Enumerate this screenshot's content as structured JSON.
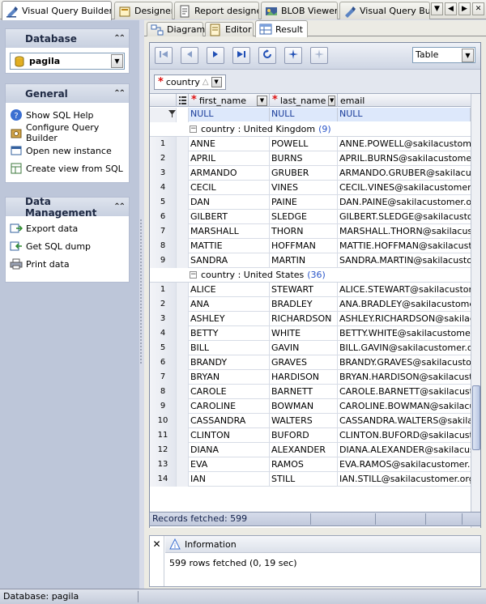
{
  "doc_tabs": [
    {
      "label": "Visual Query Builder",
      "icon": "query-builder-icon",
      "active": true
    },
    {
      "label": "Designer",
      "icon": "designer-icon",
      "active": false
    },
    {
      "label": "Report designer",
      "icon": "report-icon",
      "active": false
    },
    {
      "label": "BLOB Viewer",
      "icon": "blob-icon",
      "active": false
    },
    {
      "label": "Visual Query Builde",
      "icon": "query-builder-icon",
      "active": false
    }
  ],
  "sidebar": {
    "database_panel": {
      "title": "Database",
      "selected_db": "pagila"
    },
    "general_panel": {
      "title": "General",
      "items": [
        {
          "label": "Show SQL Help",
          "icon": "help-icon"
        },
        {
          "label": "Configure Query Builder",
          "icon": "configure-icon"
        },
        {
          "label": "Open new instance",
          "icon": "new-window-icon"
        },
        {
          "label": "Create view from SQL",
          "icon": "create-view-icon"
        }
      ]
    },
    "data_panel": {
      "title": "Data Management",
      "items": [
        {
          "label": "Export data",
          "icon": "export-icon"
        },
        {
          "label": "Get SQL dump",
          "icon": "sql-dump-icon"
        },
        {
          "label": "Print data",
          "icon": "printer-icon"
        }
      ]
    }
  },
  "sub_tabs": [
    {
      "label": "Diagram",
      "active": false
    },
    {
      "label": "Editor",
      "active": false
    },
    {
      "label": "Result",
      "active": true
    }
  ],
  "view_mode": "Table",
  "group_by": {
    "field": "country"
  },
  "columns": [
    {
      "name": "first_name",
      "required": true
    },
    {
      "name": "last_name",
      "required": true
    },
    {
      "name": "email",
      "required": false
    }
  ],
  "filter_values": [
    "NULL",
    "NULL",
    "NULL"
  ],
  "groups": [
    {
      "label": "country : United Kingdom",
      "count": "(9)",
      "rows": [
        {
          "n": "1",
          "first": "ANNE",
          "last": "POWELL",
          "email": "ANNE.POWELL@sakilacustomer.org"
        },
        {
          "n": "2",
          "first": "APRIL",
          "last": "BURNS",
          "email": "APRIL.BURNS@sakilacustomer.org"
        },
        {
          "n": "3",
          "first": "ARMANDO",
          "last": "GRUBER",
          "email": "ARMANDO.GRUBER@sakilacustomer.org"
        },
        {
          "n": "4",
          "first": "CECIL",
          "last": "VINES",
          "email": "CECIL.VINES@sakilacustomer.org"
        },
        {
          "n": "5",
          "first": "DAN",
          "last": "PAINE",
          "email": "DAN.PAINE@sakilacustomer.org"
        },
        {
          "n": "6",
          "first": "GILBERT",
          "last": "SLEDGE",
          "email": "GILBERT.SLEDGE@sakilacustomer.org"
        },
        {
          "n": "7",
          "first": "MARSHALL",
          "last": "THORN",
          "email": "MARSHALL.THORN@sakilacustomer.org"
        },
        {
          "n": "8",
          "first": "MATTIE",
          "last": "HOFFMAN",
          "email": "MATTIE.HOFFMAN@sakilacustomer.org"
        },
        {
          "n": "9",
          "first": "SANDRA",
          "last": "MARTIN",
          "email": "SANDRA.MARTIN@sakilacustomer.org"
        }
      ]
    },
    {
      "label": "country : United States",
      "count": "(36)",
      "rows": [
        {
          "n": "1",
          "first": "ALICE",
          "last": "STEWART",
          "email": "ALICE.STEWART@sakilacustomer.org"
        },
        {
          "n": "2",
          "first": "ANA",
          "last": "BRADLEY",
          "email": "ANA.BRADLEY@sakilacustomer.org"
        },
        {
          "n": "3",
          "first": "ASHLEY",
          "last": "RICHARDSON",
          "email": "ASHLEY.RICHARDSON@sakilacustomer.org"
        },
        {
          "n": "4",
          "first": "BETTY",
          "last": "WHITE",
          "email": "BETTY.WHITE@sakilacustomer.org"
        },
        {
          "n": "5",
          "first": "BILL",
          "last": "GAVIN",
          "email": "BILL.GAVIN@sakilacustomer.org"
        },
        {
          "n": "6",
          "first": "BRANDY",
          "last": "GRAVES",
          "email": "BRANDY.GRAVES@sakilacustomer.org"
        },
        {
          "n": "7",
          "first": "BRYAN",
          "last": "HARDISON",
          "email": "BRYAN.HARDISON@sakilacustomer.org"
        },
        {
          "n": "8",
          "first": "CAROLE",
          "last": "BARNETT",
          "email": "CAROLE.BARNETT@sakilacustomer.org"
        },
        {
          "n": "9",
          "first": "CAROLINE",
          "last": "BOWMAN",
          "email": "CAROLINE.BOWMAN@sakilacustomer.org"
        },
        {
          "n": "10",
          "first": "CASSANDRA",
          "last": "WALTERS",
          "email": "CASSANDRA.WALTERS@sakilacustomer.org"
        },
        {
          "n": "11",
          "first": "CLINTON",
          "last": "BUFORD",
          "email": "CLINTON.BUFORD@sakilacustomer.org"
        },
        {
          "n": "12",
          "first": "DIANA",
          "last": "ALEXANDER",
          "email": "DIANA.ALEXANDER@sakilacustomer.org"
        },
        {
          "n": "13",
          "first": "EVA",
          "last": "RAMOS",
          "email": "EVA.RAMOS@sakilacustomer.org"
        },
        {
          "n": "14",
          "first": "IAN",
          "last": "STILL",
          "email": "IAN.STILL@sakilacustomer.org"
        }
      ]
    }
  ],
  "records_status": "Records fetched: 599",
  "info_panel": {
    "title": "Information",
    "message": "599 rows fetched (0, 19 sec)"
  },
  "statusbar": {
    "text": "Database: pagila"
  }
}
